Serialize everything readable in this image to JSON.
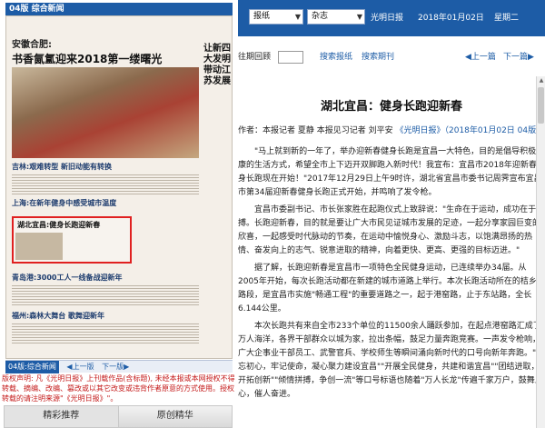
{
  "left": {
    "page_header": "04版 综合新闻",
    "newspaper": {
      "kicker": "安徽合肥:",
      "headline": "书香氤氲迎来2018第一缕曙光",
      "side_headline": "让新四大发明带动江苏发展",
      "stories": [
        "吉林:艰难转型 新旧动能有转换",
        "上海:在新年健身中感受城市温度",
        "湖北宜昌:健身长跑迎新春",
        "青岛港:3000工人一线备战迎新年",
        "福州:森林大舞台 歌舞迎新年"
      ]
    },
    "pager": {
      "section": "04版:综合新闻",
      "prev": "◀上一版",
      "next": "下一版▶"
    },
    "disclaimer": "版权声明: 凡《光明日报》上刊载作品(含标题), 未经本报或本网授权不得转载、摘编、改编、篡改或以其它改变或违背作者原意的方式使用。授权转载的请注明来源\"《光明日报》\"。",
    "tabs": [
      "精彩推荐",
      "原创精华"
    ]
  },
  "right": {
    "top_bar": {
      "select1": "报纸",
      "select2": "杂志",
      "paper_name": "光明日报",
      "date": "2018年01月02日",
      "weekday": "星期二"
    },
    "sub_bar": {
      "period_label": "往期回顾",
      "search": "搜索报纸",
      "search_mag": "搜索期刊",
      "prev": "上一篇",
      "next": "下一篇"
    },
    "article": {
      "title": "湖北宜昌：健身长跑迎新春",
      "byline_prefix": "作者：本报记者",
      "authors": "夏静 本报见习记者 刘平安",
      "source": "《光明日报》（2018年01月02日 04版）",
      "paragraphs": [
        "\"马上就到新的一年了，举办迎新春健身长跑是宜昌一大特色，目的是倡导积极健康的生活方式，希望全市上下迈开双脚跑入新时代！我宣布：宜昌市2018年迎新春健身长跑现在开始！\"2017年12月29日上午9时许，湖北省宜昌市委书记周霁宣布宜昌市第34届迎新春健身长跑正式开始，并鸣响了发令枪。",
        "宜昌市委副书记、市长张家胜在起跑仪式上致辞说：\"生命在于运动，成功在于拼搏。长跑迎新春，目的就是要让广大市民见证城市发展的足迹，一起分享家园巨变的欣喜，一起感受时代脉动的节奏，在运动中愉悦身心、激励斗志，以饱满昂扬的热情、奋发向上的志气、锐意进取的精神，向着更快、更高、更强的目标迈进。\"",
        "据了解，长跑迎新春是宜昌市一项特色全民健身运动，已连续举办34届。从2005年开始，每次长跑活动都在新建的城市道路上举行。本次长跑活动所在的桔乡路路段，是宜昌市实施\"畅通工程\"的重要道路之一，起于港窑路，止于东站路，全长6.144公里。",
        "本次长跑共有来自全市233个单位的11500余人踊跃参加，在起点港窑路汇成了万人海洋，各界干部群众以城为家，拉出条幅，鼓足力量奔跑竞赛。一声发令枪响，广大企事业干部员工、武警官兵、学校师生等瞬间涌向新时代的口号向新年奔跑。\"不忘初心，牢记使命，凝心聚力建设宜昌\"\"开展全民健身，共建和谐宜昌\"\"团结进取，开拓创新\"\"倾情拼搏，争创一流\"等口号标语也随着\"万人长龙\"传遍千家万户，鼓舞人心，催人奋进。"
      ]
    }
  },
  "colors": {
    "brand_blue": "#1d5ca6",
    "highlight_red": "#e02020",
    "disclaimer_red": "#c41a1a"
  }
}
